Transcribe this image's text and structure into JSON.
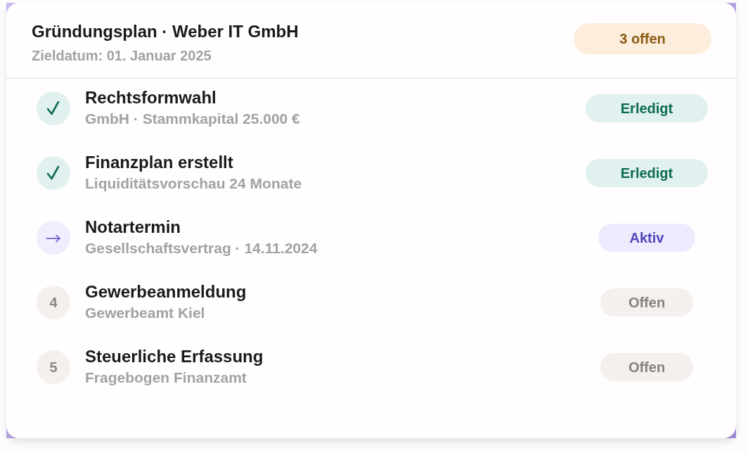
{
  "header": {
    "title": "Gründungsplan · Weber IT GmbH",
    "subtitle": "Zieldatum: 01. Januar 2025",
    "badge": "3 offen"
  },
  "steps": [
    {
      "kind": "done",
      "title": "Rechtsformwahl",
      "detail": "GmbH · Stammkapital 25.000 €",
      "status": "Erledigt"
    },
    {
      "kind": "done",
      "title": "Finanzplan erstellt",
      "detail": "Liquiditätsvorschau 24 Monate",
      "status": "Erledigt"
    },
    {
      "kind": "active",
      "title": "Notartermin",
      "detail": "Gesellschaftsvertrag · 14.11.2024",
      "status": "Aktiv"
    },
    {
      "kind": "pending",
      "number": "4",
      "title": "Gewerbeanmeldung",
      "detail": "Gewerbeamt Kiel",
      "status": "Offen"
    },
    {
      "kind": "pending",
      "number": "5",
      "title": "Steuerliche Erfassung",
      "detail": "Fragebogen Finanzamt",
      "status": "Offen"
    }
  ]
}
